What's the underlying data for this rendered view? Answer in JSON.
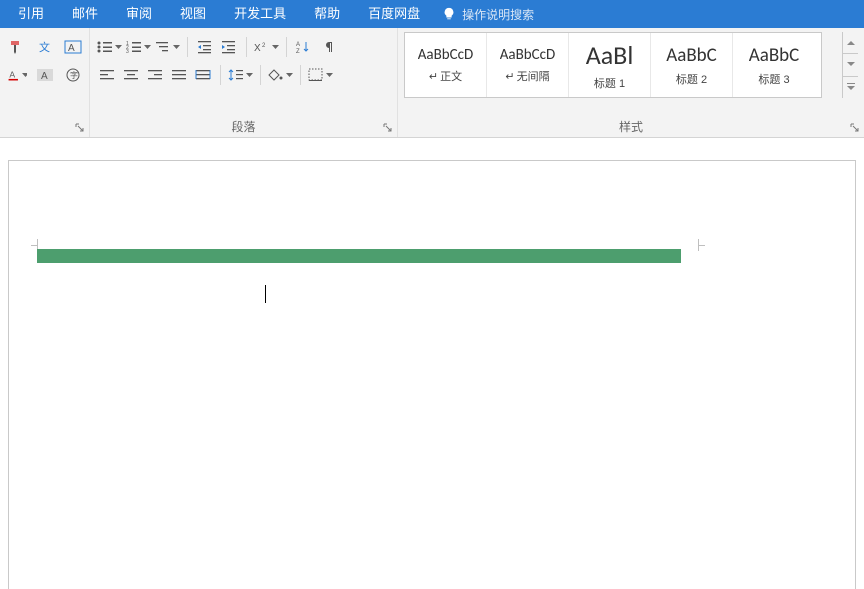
{
  "ribbon": {
    "tabs": [
      "引用",
      "邮件",
      "审阅",
      "视图",
      "开发工具",
      "帮助",
      "百度网盘"
    ],
    "tell_me": "操作说明搜索"
  },
  "font_group": {
    "label": ""
  },
  "paragraph_group": {
    "label": "段落"
  },
  "styles_group": {
    "label": "样式",
    "items": [
      {
        "preview": "AaBbCcD",
        "name": "正文",
        "size": "15px",
        "color": "#333",
        "marker": true
      },
      {
        "preview": "AaBbCcD",
        "name": "无间隔",
        "size": "15px",
        "color": "#333",
        "marker": true
      },
      {
        "preview": "AaBl",
        "name": "标题 1",
        "size": "26px",
        "color": "#333",
        "marker": false
      },
      {
        "preview": "AaBbC",
        "name": "标题 2",
        "size": "19px",
        "color": "#333",
        "marker": false
      },
      {
        "preview": "AaBbC",
        "name": "标题 3",
        "size": "19px",
        "color": "#333",
        "marker": false
      }
    ]
  },
  "document": {
    "header_text": "",
    "header_band_color": "#4d9e6e"
  }
}
